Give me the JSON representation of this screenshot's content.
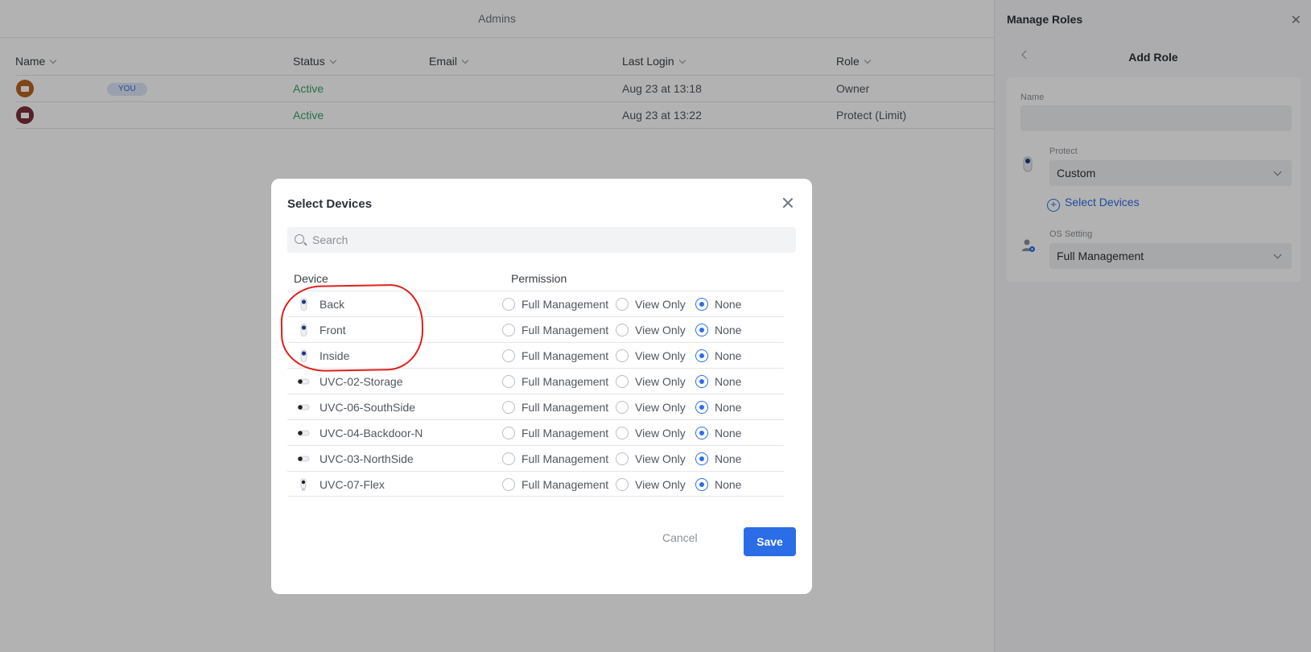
{
  "page": {
    "title": "Admins",
    "columns": [
      "Name",
      "Status",
      "Email",
      "Last Login",
      "Role"
    ],
    "you_badge": "YOU",
    "rows": [
      {
        "status": "Active",
        "last_login": "Aug 23 at 13:18",
        "role": "Owner",
        "avatar_color": "#b5651d"
      },
      {
        "status": "Active",
        "last_login": "Aug 23 at 13:22",
        "role": "Protect (Limit)",
        "avatar_color": "#7a2e3a"
      }
    ]
  },
  "side": {
    "title": "Manage Roles",
    "subtitle": "Add Role",
    "name_label": "Name",
    "name_value": "",
    "protect_label": "Protect",
    "protect_value": "Custom",
    "select_devices": "Select Devices",
    "os_label": "OS Setting",
    "os_value": "Full Management"
  },
  "modal": {
    "title": "Select Devices",
    "search_placeholder": "Search",
    "device_header": "Device",
    "permission_header": "Permission",
    "options": [
      "Full Management",
      "View Only",
      "None"
    ],
    "devices": [
      {
        "name": "Back",
        "icon": "doorbell-camera-icon",
        "selected": "None"
      },
      {
        "name": "Front",
        "icon": "doorbell-camera-icon",
        "selected": "None"
      },
      {
        "name": "Inside",
        "icon": "doorbell-camera-icon",
        "selected": "None"
      },
      {
        "name": "UVC-02-Storage",
        "icon": "bullet-camera-icon",
        "selected": "None"
      },
      {
        "name": "UVC-06-SouthSide",
        "icon": "bullet-camera-icon",
        "selected": "None"
      },
      {
        "name": "UVC-04-Backdoor-N",
        "icon": "bullet-camera-icon",
        "selected": "None"
      },
      {
        "name": "UVC-03-NorthSide",
        "icon": "bullet-camera-icon",
        "selected": "None"
      },
      {
        "name": "UVC-07-Flex",
        "icon": "flex-camera-icon",
        "selected": "None"
      }
    ],
    "cancel": "Cancel",
    "save": "Save"
  },
  "colors": {
    "accent": "#2b6de6",
    "active_status": "#38a169",
    "annotation": "#e0201c"
  }
}
